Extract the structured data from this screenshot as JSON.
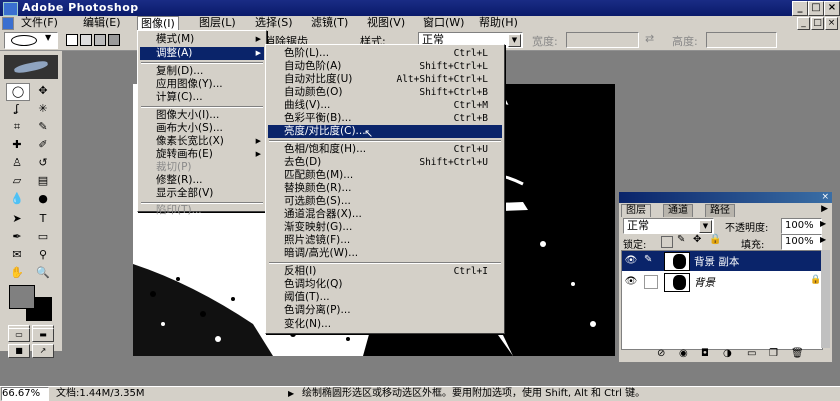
{
  "window": {
    "title": "Adobe Photoshop",
    "min": "_",
    "max": "□",
    "close": "×",
    "doc_min": "_",
    "doc_max": "□",
    "doc_close": "×"
  },
  "menubar": [
    "文件(F)",
    "编辑(E)",
    "图像(I)",
    "图层(L)",
    "选择(S)",
    "滤镜(T)",
    "视图(V)",
    "窗口(W)",
    "帮助(H)"
  ],
  "options": {
    "antialias": "消除锯齿",
    "style_label": "样式:",
    "style_value": "正常",
    "width_label": "宽度:",
    "height_label": "高度:"
  },
  "image_menu": [
    {
      "label": "模式(M)",
      "arrow": "▶"
    },
    {
      "label": "调整(A)",
      "arrow": "▶"
    },
    {
      "label": "复制(D)..."
    },
    {
      "label": "应用图像(Y)..."
    },
    {
      "label": "计算(C)..."
    },
    {
      "label": "图像大小(I)..."
    },
    {
      "label": "画布大小(S)..."
    },
    {
      "label": "像素长宽比(X)",
      "arrow": "▶"
    },
    {
      "label": "旋转画布(E)",
      "arrow": "▶"
    },
    {
      "label": "裁切(P)"
    },
    {
      "label": "修整(R)..."
    },
    {
      "label": "显示全部(V)"
    },
    {
      "label": "陷印(T)..."
    }
  ],
  "adjust_menu": [
    {
      "label": "色阶(L)...",
      "sc": "Ctrl+L"
    },
    {
      "label": "自动色阶(A)",
      "sc": "Shift+Ctrl+L"
    },
    {
      "label": "自动对比度(U)",
      "sc": "Alt+Shift+Ctrl+L"
    },
    {
      "label": "自动颜色(O)",
      "sc": "Shift+Ctrl+B"
    },
    {
      "label": "曲线(V)...",
      "sc": "Ctrl+M"
    },
    {
      "label": "色彩平衡(B)...",
      "sc": "Ctrl+B"
    },
    {
      "label": "亮度/对比度(C)..."
    },
    {
      "label": "色相/饱和度(H)...",
      "sc": "Ctrl+U"
    },
    {
      "label": "去色(D)",
      "sc": "Shift+Ctrl+U"
    },
    {
      "label": "匹配颜色(M)..."
    },
    {
      "label": "替换颜色(R)..."
    },
    {
      "label": "可选颜色(S)..."
    },
    {
      "label": "通道混合器(X)..."
    },
    {
      "label": "渐变映射(G)..."
    },
    {
      "label": "照片滤镜(F)..."
    },
    {
      "label": "暗调/高光(W)..."
    },
    {
      "label": "反相(I)",
      "sc": "Ctrl+I"
    },
    {
      "label": "色调均化(Q)"
    },
    {
      "label": "阈值(T)..."
    },
    {
      "label": "色调分离(P)..."
    },
    {
      "label": "变化(N)..."
    }
  ],
  "layers": {
    "tabs": [
      "图层",
      "通道",
      "路径"
    ],
    "blend": "正常",
    "opacity_label": "不透明度:",
    "opacity": "100%",
    "lock_label": "锁定:",
    "fill_label": "填充:",
    "fill": "100%",
    "rows": [
      {
        "name": "背景 副本"
      },
      {
        "name": "背景"
      }
    ]
  },
  "status": {
    "zoom": "66.67%",
    "doc": "文档:1.44M/3.35M",
    "arrow": "▶",
    "hint": "绘制椭圆形选区或移动选区外框。要用附加选项，使用 Shift, Alt 和 Ctrl 键。"
  },
  "colors": {
    "title": "#0a246a",
    "highlight": "#0a246a",
    "chrome": "#d4d0c8"
  }
}
